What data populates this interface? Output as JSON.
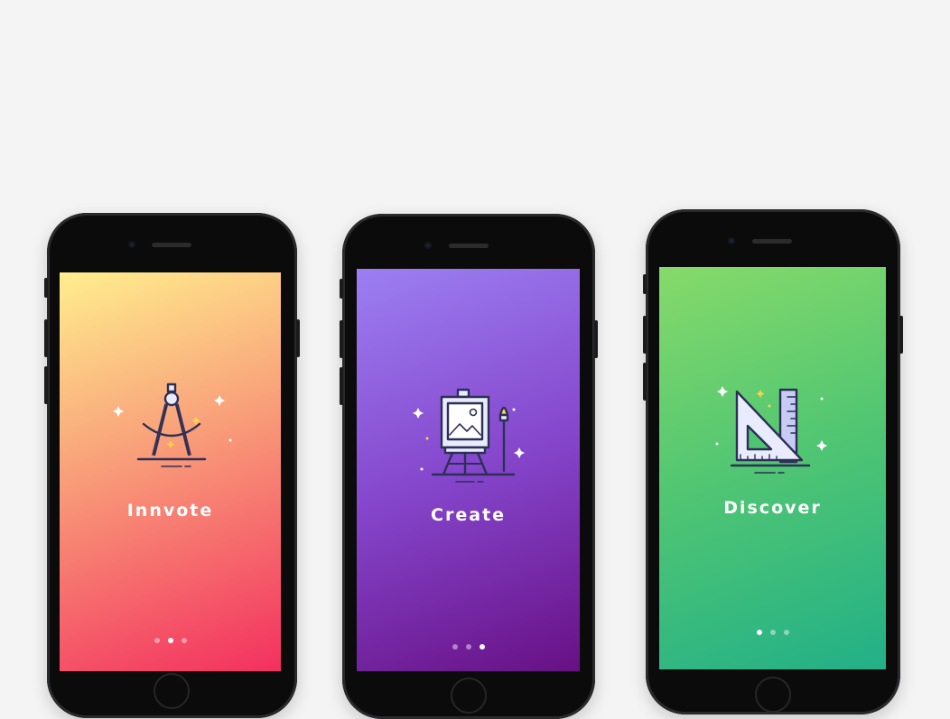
{
  "screens": [
    {
      "id": "innovate",
      "title": "Innvote",
      "icon": "compass-icon",
      "gradient": [
        "#ffe98c",
        "#f79a7a",
        "#f3305f"
      ],
      "active_dot": 1
    },
    {
      "id": "create",
      "title": "Create",
      "icon": "easel-icon",
      "gradient": [
        "#9a7cf0",
        "#8346c9",
        "#6a1389"
      ],
      "active_dot": 2
    },
    {
      "id": "discover",
      "title": "Discover",
      "icon": "set-square-ruler-icon",
      "gradient": [
        "#84d86b",
        "#4cc473",
        "#23b186"
      ],
      "active_dot": 0
    }
  ],
  "colors": {
    "icon_stroke": "#2d2f55",
    "icon_fill": "#e9ecff",
    "sparkle": "#ffffff",
    "sparkle_gold": "#ffd34d"
  }
}
